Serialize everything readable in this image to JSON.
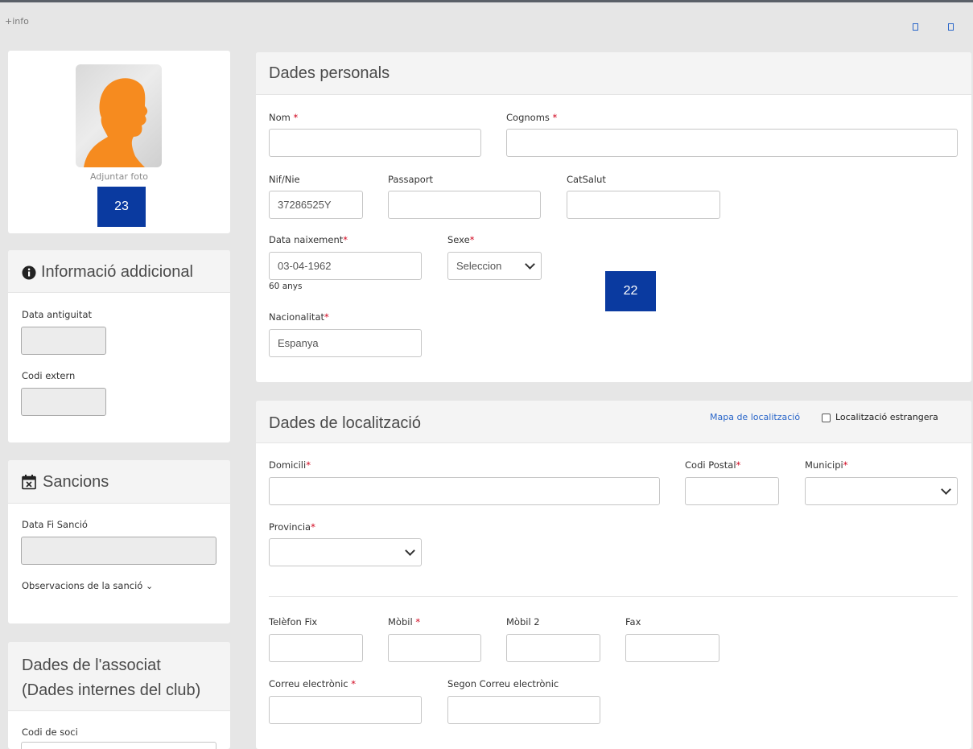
{
  "top": {
    "info_link": "+info",
    "icons": [
      "window-icon",
      "window-icon"
    ]
  },
  "photo_card": {
    "attach_label": "Adjuntar foto",
    "badge": "23"
  },
  "additional": {
    "title": "Informació addicional",
    "icon": "info-circle-icon",
    "seniority_label": "Data antiguitat",
    "seniority_value": "",
    "external_code_label": "Codi extern",
    "external_code_value": ""
  },
  "sanctions": {
    "title": "Sancions",
    "icon": "calendar-x-icon",
    "end_date_label": "Data Fi Sanció",
    "end_date_value": "",
    "observations_label": "Observacions de la sanció",
    "observations_toggle": "⌄"
  },
  "associate": {
    "title_line1": "Dades de l'associat",
    "title_line2": "(Dades internes del club)",
    "member_code_label": "Codi de soci"
  },
  "personal": {
    "title": "Dades personals",
    "name_label": "Nom",
    "surname_label": "Cognoms",
    "nif_label": "Nif/Nie",
    "nif_value": "37286525Y",
    "passport_label": "Passaport",
    "catsalut_label": "CatSalut",
    "birth_label": "Data naixement",
    "birth_value": "03-04-1962",
    "age_text": "60 anys",
    "sex_label": "Sexe",
    "sex_value": "Seleccion",
    "nationality_label": "Nacionalitat",
    "nationality_value": "Espanya",
    "badge": "22",
    "required_mark": "*"
  },
  "location": {
    "title": "Dades de localització",
    "map_link": "Mapa de localització",
    "foreign_label": "Localització estrangera",
    "address_label": "Domicili",
    "postal_label": "Codi Postal",
    "town_label": "Municipi",
    "province_label": "Provincia",
    "phone_label": "Telèfon Fix",
    "mobile_label": "Mòbil",
    "mobile2_label": "Mòbil 2",
    "fax_label": "Fax",
    "email_label": "Correu electrònic",
    "email2_label": "Segon Correu electrònic"
  },
  "colors": {
    "accent": "#0a3aa0",
    "link": "#2a66c9",
    "required": "#d0021b",
    "avatar": "#f68b1f"
  }
}
